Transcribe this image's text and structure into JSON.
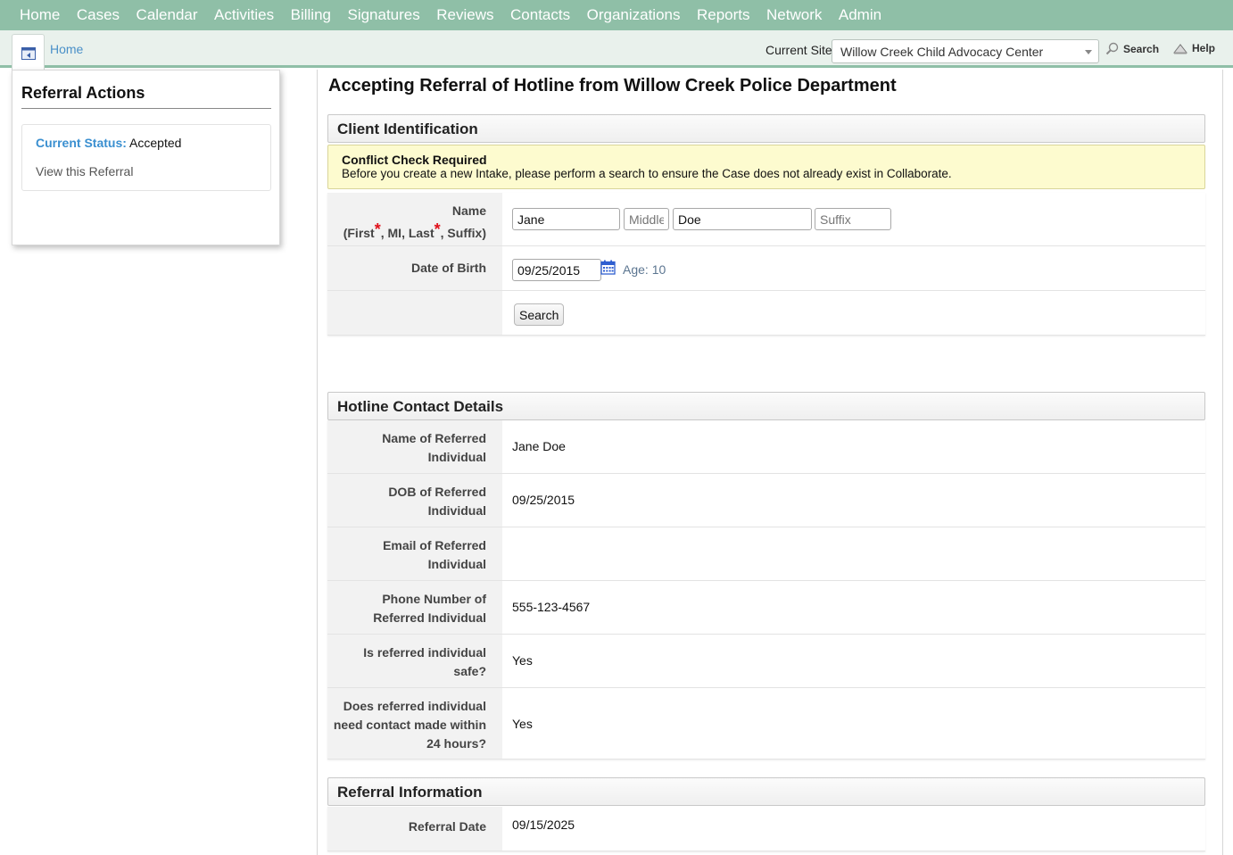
{
  "nav": {
    "items": [
      {
        "label": "Home"
      },
      {
        "label": "Cases"
      },
      {
        "label": "Calendar"
      },
      {
        "label": "Activities"
      },
      {
        "label": "Billing"
      },
      {
        "label": "Signatures"
      },
      {
        "label": "Reviews"
      },
      {
        "label": "Contacts"
      },
      {
        "label": "Organizations"
      },
      {
        "label": "Reports"
      },
      {
        "label": "Network"
      },
      {
        "label": "Admin"
      }
    ]
  },
  "subbar": {
    "breadcrumb": "Home",
    "site_label": "Current Site",
    "site_value": "Willow Creek Child Advocacy Center",
    "search_label": "Search",
    "help_label": "Help"
  },
  "sidebar": {
    "title": "Referral Actions",
    "status_key": "Current Status:",
    "status_value": "Accepted",
    "view_link": "View this Referral"
  },
  "main": {
    "title": "Accepting Referral of Hotline from Willow Creek Police Department"
  },
  "client_identification": {
    "heading": "Client Identification",
    "alert_title": "Conflict Check Required",
    "alert_text": "Before you create a new Intake, please perform a search to ensure the Case does not already exist in Collaborate.",
    "name_label_1": "Name",
    "name_label_a": "(First",
    "name_label_b": ", MI, Last",
    "name_label_c": ", Suffix)",
    "required_mark": "*",
    "first_value": "Jane",
    "middle_placeholder": "Middle",
    "last_value": "Doe",
    "suffix_placeholder": "Suffix",
    "dob_label": "Date of Birth",
    "dob_value": "09/25/2015",
    "age_text": "Age: 10",
    "search_button": "Search"
  },
  "hotline": {
    "heading": "Hotline Contact Details",
    "rows": [
      {
        "label_1": "Name of Referred",
        "label_2": "Individual",
        "value": "Jane Doe"
      },
      {
        "label_1": "DOB of Referred",
        "label_2": "Individual",
        "value": "09/25/2015"
      },
      {
        "label_1": "Email of Referred",
        "label_2": "Individual",
        "value": ""
      },
      {
        "label_1": "Phone Number of",
        "label_2": "Referred Individual",
        "value": "555-123-4567"
      },
      {
        "label_1": "Is referred individual",
        "label_2": "safe?",
        "value": "Yes"
      },
      {
        "label_1": "Does referred individual",
        "label_2": "need contact made within",
        "label_3": "24 hours?",
        "value": "Yes"
      }
    ]
  },
  "referral_info": {
    "heading": "Referral Information",
    "date_label": "Referral Date",
    "date_value": "09/15/2025"
  },
  "colors": {
    "nav_bg": "#8fbfa7",
    "link": "#4a90c8",
    "status_key": "#3a8fd0",
    "alert_bg": "#fdfbcf",
    "required": "#e0101a"
  }
}
